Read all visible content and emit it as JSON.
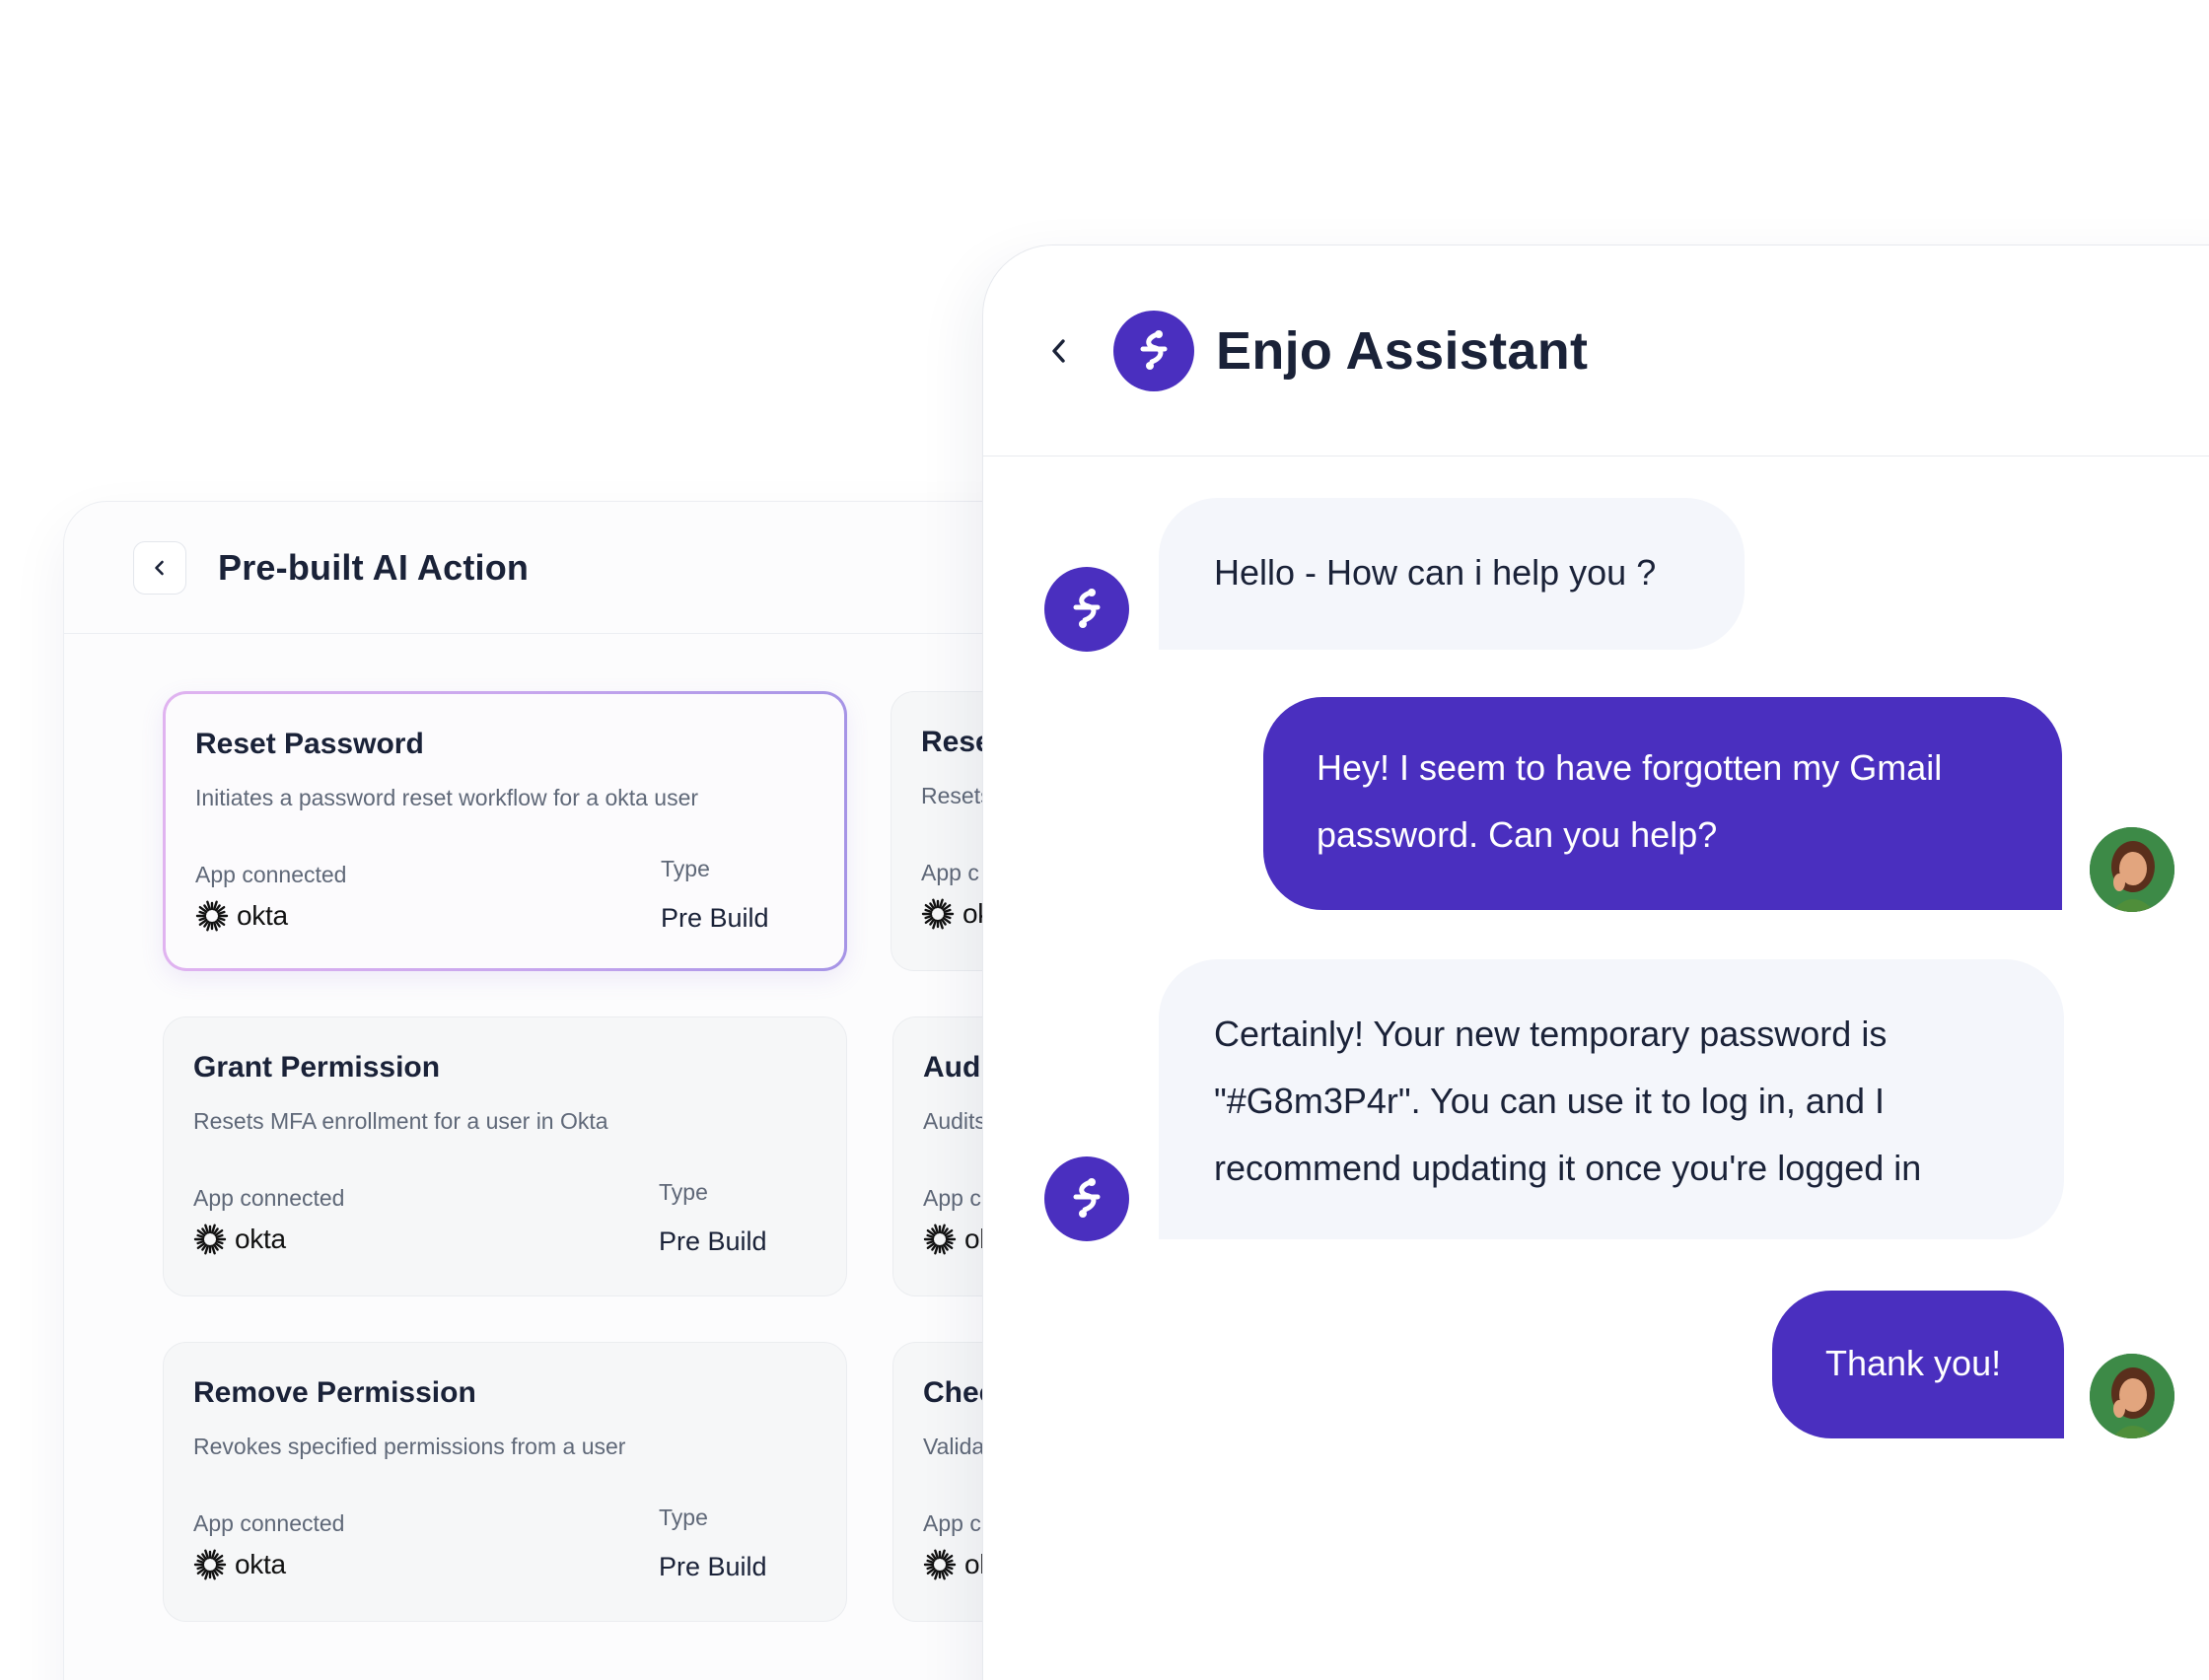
{
  "actions": {
    "title": "Pre-built AI Action",
    "cards": [
      {
        "title": "Reset Password",
        "description": "Initiates a password reset workflow for a okta user",
        "app_label": "App connected",
        "app": "okta",
        "type_label": "Type",
        "type": "Pre Build"
      },
      {
        "title": "Grant Permission",
        "description": "Resets MFA enrollment for a user in Okta",
        "app_label": "App connected",
        "app": "okta",
        "type_label": "Type",
        "type": "Pre Build"
      },
      {
        "title": "Remove Permission",
        "description": "Revokes specified permissions from a user",
        "app_label": "App connected",
        "app": "okta",
        "type_label": "Type",
        "type": "Pre Build"
      }
    ],
    "partial_cards": [
      {
        "title": "Rese",
        "description": "Resets",
        "app_label": "App c",
        "app": "ok"
      },
      {
        "title": "Audi",
        "description": "Audits",
        "app_label": "App c",
        "app": "ol"
      },
      {
        "title": "Chec",
        "description": "Valida",
        "app_label": "App c",
        "app": "ol"
      }
    ]
  },
  "chat": {
    "title": "Enjo Assistant",
    "messages": [
      {
        "from": "bot",
        "text": "Hello - How can i help you ?"
      },
      {
        "from": "user",
        "line1": "Hey! I seem to have forgotten my Gmail",
        "line2": "password. Can you help?"
      },
      {
        "from": "bot",
        "line1": "Certainly! Your new temporary password is",
        "line2": "\"#G8m3P4r\". You can use it to log in, and I",
        "line3": "recommend updating it once you're logged in"
      },
      {
        "from": "user",
        "text": "Thank you!"
      }
    ]
  },
  "colors": {
    "brand": "#4a2fbf",
    "bot_bubble": "#f4f6fb",
    "text": "#1a2238",
    "muted": "#5f6878"
  }
}
